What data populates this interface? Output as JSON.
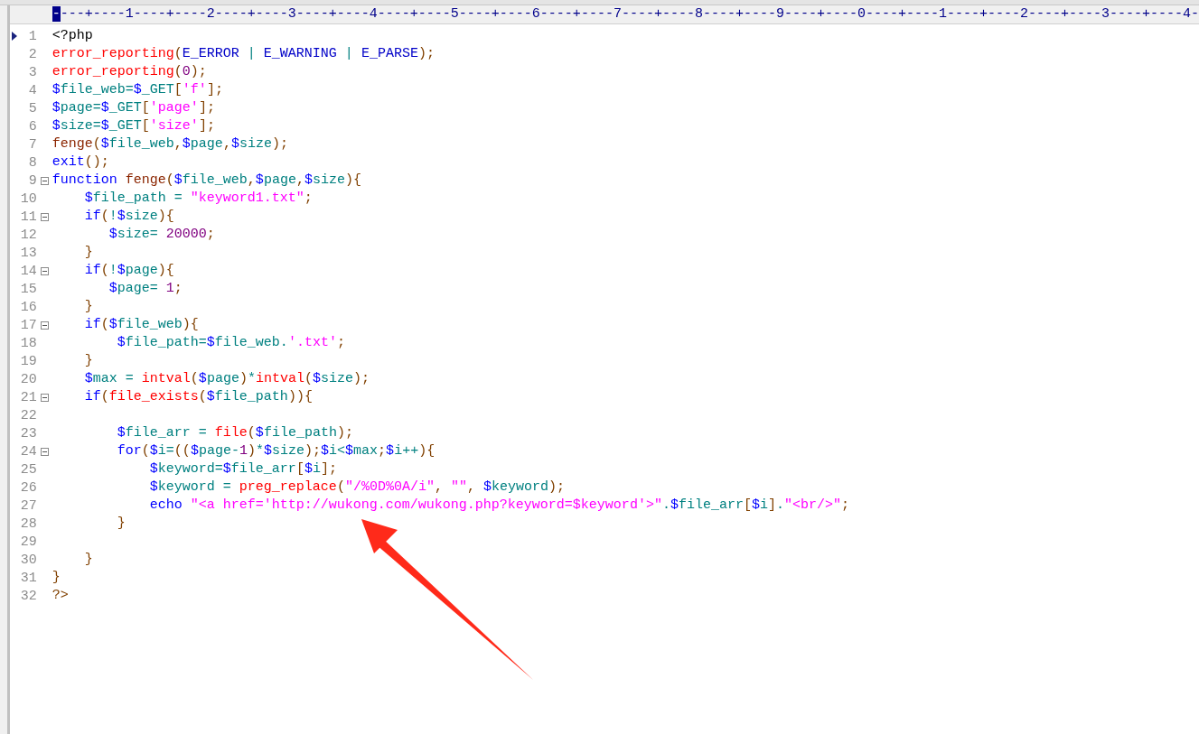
{
  "ruler": {
    "cursor": "-",
    "marks": "---+----1----+----2----+----3----+----4----+----5----+----6----+----7----+----8----+----9----+----0----+----1----+----2----+----3----+----4-"
  },
  "lines": [
    {
      "number": "1",
      "current": true,
      "fold": false,
      "tokens": [
        {
          "kind": "plain",
          "text": "<?php"
        }
      ]
    },
    {
      "number": "2",
      "current": false,
      "fold": false,
      "tokens": [
        {
          "kind": "fn",
          "text": "error_reporting"
        },
        {
          "kind": "pun",
          "text": "("
        },
        {
          "kind": "con",
          "text": "E_ERROR "
        },
        {
          "kind": "op",
          "text": "| "
        },
        {
          "kind": "con",
          "text": "E_WARNING "
        },
        {
          "kind": "op",
          "text": "| "
        },
        {
          "kind": "con",
          "text": "E_PARSE"
        },
        {
          "kind": "pun",
          "text": ");"
        }
      ]
    },
    {
      "number": "3",
      "current": false,
      "fold": false,
      "tokens": [
        {
          "kind": "fn",
          "text": "error_reporting"
        },
        {
          "kind": "pun",
          "text": "("
        },
        {
          "kind": "num",
          "text": "0"
        },
        {
          "kind": "pun",
          "text": ");"
        }
      ]
    },
    {
      "number": "4",
      "current": false,
      "fold": false,
      "tokens": [
        {
          "kind": "var",
          "text": "$file_web"
        },
        {
          "kind": "op",
          "text": "="
        },
        {
          "kind": "var",
          "text": "$_GET"
        },
        {
          "kind": "pun",
          "text": "["
        },
        {
          "kind": "str",
          "text": "'f'"
        },
        {
          "kind": "pun",
          "text": "];"
        }
      ]
    },
    {
      "number": "5",
      "current": false,
      "fold": false,
      "tokens": [
        {
          "kind": "var",
          "text": "$page"
        },
        {
          "kind": "op",
          "text": "="
        },
        {
          "kind": "var",
          "text": "$_GET"
        },
        {
          "kind": "pun",
          "text": "["
        },
        {
          "kind": "str",
          "text": "'page'"
        },
        {
          "kind": "pun",
          "text": "];"
        }
      ]
    },
    {
      "number": "6",
      "current": false,
      "fold": false,
      "tokens": [
        {
          "kind": "var",
          "text": "$size"
        },
        {
          "kind": "op",
          "text": "="
        },
        {
          "kind": "var",
          "text": "$_GET"
        },
        {
          "kind": "pun",
          "text": "["
        },
        {
          "kind": "str",
          "text": "'size'"
        },
        {
          "kind": "pun",
          "text": "];"
        }
      ]
    },
    {
      "number": "7",
      "current": false,
      "fold": false,
      "tokens": [
        {
          "kind": "ufn",
          "text": "fenge"
        },
        {
          "kind": "pun",
          "text": "("
        },
        {
          "kind": "var",
          "text": "$file_web"
        },
        {
          "kind": "pun",
          "text": ","
        },
        {
          "kind": "var",
          "text": "$page"
        },
        {
          "kind": "pun",
          "text": ","
        },
        {
          "kind": "var",
          "text": "$size"
        },
        {
          "kind": "pun",
          "text": ");"
        }
      ]
    },
    {
      "number": "8",
      "current": false,
      "fold": false,
      "tokens": [
        {
          "kind": "kw",
          "text": "exit"
        },
        {
          "kind": "pun",
          "text": "();"
        }
      ]
    },
    {
      "number": "9",
      "current": false,
      "fold": true,
      "tokens": [
        {
          "kind": "kw",
          "text": "function "
        },
        {
          "kind": "ufn",
          "text": "fenge"
        },
        {
          "kind": "pun",
          "text": "("
        },
        {
          "kind": "var",
          "text": "$file_web"
        },
        {
          "kind": "pun",
          "text": ","
        },
        {
          "kind": "var",
          "text": "$page"
        },
        {
          "kind": "pun",
          "text": ","
        },
        {
          "kind": "var",
          "text": "$size"
        },
        {
          "kind": "pun",
          "text": "){"
        }
      ]
    },
    {
      "number": "10",
      "current": false,
      "fold": false,
      "tokens": [
        {
          "kind": "var",
          "text": "    $file_path"
        },
        {
          "kind": "op",
          "text": " = "
        },
        {
          "kind": "str",
          "text": "\"keyword1.txt\""
        },
        {
          "kind": "pun",
          "text": ";"
        }
      ]
    },
    {
      "number": "11",
      "current": false,
      "fold": true,
      "tokens": [
        {
          "kind": "kw",
          "text": "    if"
        },
        {
          "kind": "pun",
          "text": "("
        },
        {
          "kind": "op",
          "text": "!"
        },
        {
          "kind": "var",
          "text": "$size"
        },
        {
          "kind": "pun",
          "text": "){"
        }
      ]
    },
    {
      "number": "12",
      "current": false,
      "fold": false,
      "tokens": [
        {
          "kind": "var",
          "text": "       $size"
        },
        {
          "kind": "op",
          "text": "= "
        },
        {
          "kind": "num",
          "text": "20000"
        },
        {
          "kind": "pun",
          "text": ";"
        }
      ]
    },
    {
      "number": "13",
      "current": false,
      "fold": false,
      "tokens": [
        {
          "kind": "pun",
          "text": "    }"
        }
      ]
    },
    {
      "number": "14",
      "current": false,
      "fold": true,
      "tokens": [
        {
          "kind": "kw",
          "text": "    if"
        },
        {
          "kind": "pun",
          "text": "("
        },
        {
          "kind": "op",
          "text": "!"
        },
        {
          "kind": "var",
          "text": "$page"
        },
        {
          "kind": "pun",
          "text": "){"
        }
      ]
    },
    {
      "number": "15",
      "current": false,
      "fold": false,
      "tokens": [
        {
          "kind": "var",
          "text": "       $page"
        },
        {
          "kind": "op",
          "text": "= "
        },
        {
          "kind": "num",
          "text": "1"
        },
        {
          "kind": "pun",
          "text": ";"
        }
      ]
    },
    {
      "number": "16",
      "current": false,
      "fold": false,
      "tokens": [
        {
          "kind": "pun",
          "text": "    }"
        }
      ]
    },
    {
      "number": "17",
      "current": false,
      "fold": true,
      "tokens": [
        {
          "kind": "kw",
          "text": "    if"
        },
        {
          "kind": "pun",
          "text": "("
        },
        {
          "kind": "var",
          "text": "$file_web"
        },
        {
          "kind": "pun",
          "text": "){"
        }
      ]
    },
    {
      "number": "18",
      "current": false,
      "fold": false,
      "tokens": [
        {
          "kind": "var",
          "text": "        $file_path"
        },
        {
          "kind": "op",
          "text": "="
        },
        {
          "kind": "var",
          "text": "$file_web"
        },
        {
          "kind": "op",
          "text": "."
        },
        {
          "kind": "str",
          "text": "'.txt'"
        },
        {
          "kind": "pun",
          "text": ";"
        }
      ]
    },
    {
      "number": "19",
      "current": false,
      "fold": false,
      "tokens": [
        {
          "kind": "pun",
          "text": "    }"
        }
      ]
    },
    {
      "number": "20",
      "current": false,
      "fold": false,
      "tokens": [
        {
          "kind": "var",
          "text": "    $max"
        },
        {
          "kind": "op",
          "text": " = "
        },
        {
          "kind": "fn",
          "text": "intval"
        },
        {
          "kind": "pun",
          "text": "("
        },
        {
          "kind": "var",
          "text": "$page"
        },
        {
          "kind": "pun",
          "text": ")"
        },
        {
          "kind": "op",
          "text": "*"
        },
        {
          "kind": "fn",
          "text": "intval"
        },
        {
          "kind": "pun",
          "text": "("
        },
        {
          "kind": "var",
          "text": "$size"
        },
        {
          "kind": "pun",
          "text": ");"
        }
      ]
    },
    {
      "number": "21",
      "current": false,
      "fold": true,
      "tokens": [
        {
          "kind": "kw",
          "text": "    if"
        },
        {
          "kind": "pun",
          "text": "("
        },
        {
          "kind": "fn",
          "text": "file_exists"
        },
        {
          "kind": "pun",
          "text": "("
        },
        {
          "kind": "var",
          "text": "$file_path"
        },
        {
          "kind": "pun",
          "text": ")){"
        }
      ]
    },
    {
      "number": "22",
      "current": false,
      "fold": false
    },
    {
      "number": "23",
      "current": false,
      "fold": false,
      "tokens": [
        {
          "kind": "var",
          "text": "        $file_arr"
        },
        {
          "kind": "op",
          "text": " = "
        },
        {
          "kind": "fn",
          "text": "file"
        },
        {
          "kind": "pun",
          "text": "("
        },
        {
          "kind": "var",
          "text": "$file_path"
        },
        {
          "kind": "pun",
          "text": ");"
        }
      ]
    },
    {
      "number": "24",
      "current": false,
      "fold": true,
      "tokens": [
        {
          "kind": "kw",
          "text": "        for"
        },
        {
          "kind": "pun",
          "text": "("
        },
        {
          "kind": "var",
          "text": "$i"
        },
        {
          "kind": "op",
          "text": "="
        },
        {
          "kind": "pun",
          "text": "(("
        },
        {
          "kind": "var",
          "text": "$page"
        },
        {
          "kind": "op",
          "text": "-"
        },
        {
          "kind": "num",
          "text": "1"
        },
        {
          "kind": "pun",
          "text": ")"
        },
        {
          "kind": "op",
          "text": "*"
        },
        {
          "kind": "var",
          "text": "$size"
        },
        {
          "kind": "pun",
          "text": ");"
        },
        {
          "kind": "var",
          "text": "$i"
        },
        {
          "kind": "op",
          "text": "<"
        },
        {
          "kind": "var",
          "text": "$max"
        },
        {
          "kind": "pun",
          "text": ";"
        },
        {
          "kind": "var",
          "text": "$i"
        },
        {
          "kind": "op",
          "text": "++"
        },
        {
          "kind": "pun",
          "text": "){"
        }
      ]
    },
    {
      "number": "25",
      "current": false,
      "fold": false,
      "tokens": [
        {
          "kind": "var",
          "text": "            $keyword"
        },
        {
          "kind": "op",
          "text": "="
        },
        {
          "kind": "var",
          "text": "$file_arr"
        },
        {
          "kind": "pun",
          "text": "["
        },
        {
          "kind": "var",
          "text": "$i"
        },
        {
          "kind": "pun",
          "text": "];"
        }
      ]
    },
    {
      "number": "26",
      "current": false,
      "fold": false,
      "tokens": [
        {
          "kind": "var",
          "text": "            $keyword"
        },
        {
          "kind": "op",
          "text": " = "
        },
        {
          "kind": "fn",
          "text": "preg_replace"
        },
        {
          "kind": "pun",
          "text": "("
        },
        {
          "kind": "str",
          "text": "\"/%0D%0A/i\""
        },
        {
          "kind": "pun",
          "text": ", "
        },
        {
          "kind": "str",
          "text": "\"\""
        },
        {
          "kind": "pun",
          "text": ", "
        },
        {
          "kind": "var",
          "text": "$keyword"
        },
        {
          "kind": "pun",
          "text": ");"
        }
      ]
    },
    {
      "number": "27",
      "current": false,
      "fold": false,
      "tokens": [
        {
          "kind": "kw",
          "text": "            echo "
        },
        {
          "kind": "str",
          "text": "\"<a href='http://wukong.com/wukong.php?keyword=$keyword'>\""
        },
        {
          "kind": "op",
          "text": "."
        },
        {
          "kind": "var",
          "text": "$file_arr"
        },
        {
          "kind": "pun",
          "text": "["
        },
        {
          "kind": "var",
          "text": "$i"
        },
        {
          "kind": "pun",
          "text": "]"
        },
        {
          "kind": "op",
          "text": "."
        },
        {
          "kind": "str",
          "text": "\"<br/>\""
        },
        {
          "kind": "pun",
          "text": ";"
        }
      ]
    },
    {
      "number": "28",
      "current": false,
      "fold": false,
      "tokens": [
        {
          "kind": "pun",
          "text": "        }"
        }
      ]
    },
    {
      "number": "29",
      "current": false,
      "fold": false
    },
    {
      "number": "30",
      "current": false,
      "fold": false,
      "tokens": [
        {
          "kind": "pun",
          "text": "    }"
        }
      ]
    },
    {
      "number": "31",
      "current": false,
      "fold": false,
      "tokens": [
        {
          "kind": "pun",
          "text": "}"
        }
      ]
    },
    {
      "number": "32",
      "current": false,
      "fold": false,
      "tokens": [
        {
          "kind": "pun",
          "text": "?>"
        }
      ]
    }
  ]
}
